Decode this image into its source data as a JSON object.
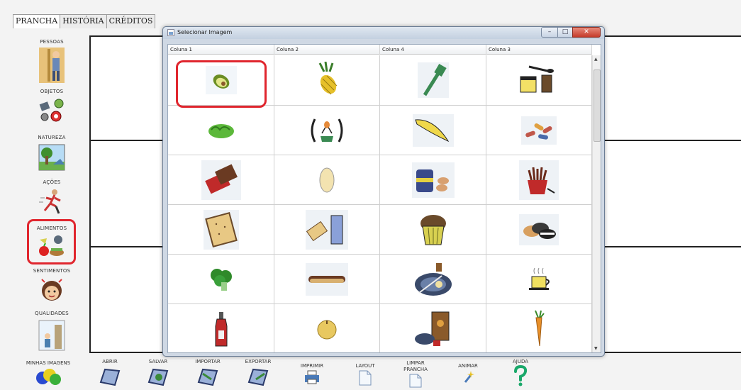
{
  "tabs": [
    "PRANCHA",
    "HISTÓRIA",
    "CRÉDITOS"
  ],
  "categories": [
    "PESSOAS",
    "OBJETOS",
    "NATUREZA",
    "AÇÕES",
    "ALIMENTOS",
    "SENTIMENTOS",
    "QUALIDADES"
  ],
  "dialog": {
    "title": "Selecionar Imagem",
    "columns": [
      "Coluna 1",
      "Coluna 2",
      "Coluna 4",
      "Coluna 3"
    ]
  },
  "food_grid": [
    [
      "avocado-icon",
      "pineapple-icon",
      "spatula-icon",
      "breakfast-items-icon"
    ],
    [
      "lettuce-icon",
      "food-selection-icon",
      "banana-icon",
      "sausages-icon"
    ],
    [
      "chocolate-bar-icon",
      "potato-icon",
      "protein-snack-icon",
      "fries-icon"
    ],
    [
      "cracker-icon",
      "cracker-and-drink-icon",
      "muffin-icon",
      "cookies-icon"
    ],
    [
      "broccoli-icon",
      "hot-dog-icon",
      "meal-plate-icon",
      "coffee-cup-icon"
    ],
    [
      "ketchup-bottle-icon",
      "onion-icon",
      "cereal-breakfast-icon",
      "carrot-icon"
    ]
  ],
  "toolbar": {
    "minhas_imagens": "MINHAS IMAGENS",
    "abrir": "ABRIR",
    "salvar": "SALVAR",
    "importar": "IMPORTAR",
    "exportar": "EXPORTAR",
    "imprimir": "IMPRIMIR",
    "layout": "LAYOUT",
    "limpar_line1": "LIMPAR",
    "limpar_line2": "PRANCHA",
    "animar": "ANIMAR",
    "ajuda": "AJUDA"
  },
  "colors": {
    "highlight": "#e0262e",
    "board_line": "#222222"
  }
}
